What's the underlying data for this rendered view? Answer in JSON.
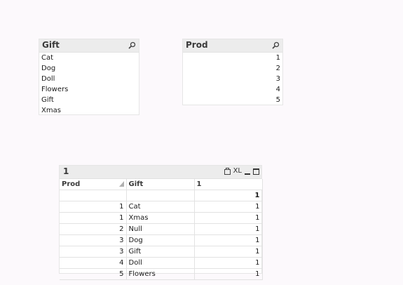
{
  "listboxes": {
    "gift": {
      "title": "Gift",
      "items": [
        "Cat",
        "Dog",
        "Doll",
        "Flowers",
        "Gift",
        "Xmas"
      ]
    },
    "prod": {
      "title": "Prod",
      "items": [
        "1",
        "2",
        "3",
        "4",
        "5"
      ]
    }
  },
  "table": {
    "title": "1",
    "xl_label": "XL",
    "headers": [
      "Prod",
      "Gift",
      "1"
    ],
    "total": [
      "",
      "",
      "1"
    ],
    "rows": [
      [
        "1",
        "Cat",
        "1"
      ],
      [
        "1",
        "Xmas",
        "1"
      ],
      [
        "2",
        "Null",
        "1"
      ],
      [
        "3",
        "Dog",
        "1"
      ],
      [
        "3",
        "Gift",
        "1"
      ],
      [
        "4",
        "Doll",
        "1"
      ],
      [
        "5",
        "Flowers",
        "1"
      ]
    ]
  }
}
